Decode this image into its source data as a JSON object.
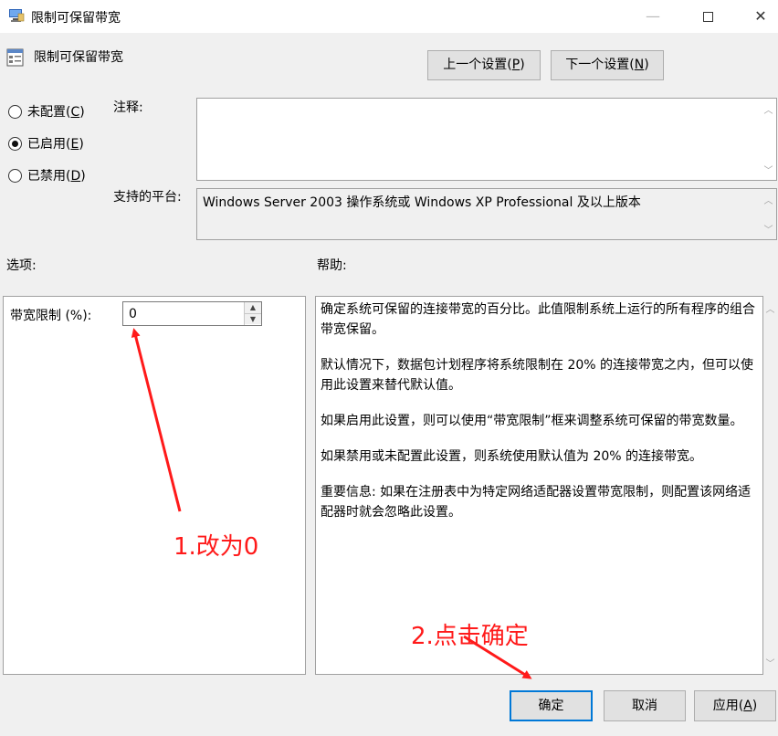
{
  "window": {
    "title": "限制可保留带宽",
    "min_glyph": "—",
    "close_glyph": "✕"
  },
  "header": {
    "title": "限制可保留带宽"
  },
  "nav": {
    "prev": {
      "label": "上一个设置(",
      "key": "P",
      "end": ")"
    },
    "next": {
      "label": "下一个设置(",
      "key": "N",
      "end": ")"
    }
  },
  "state": {
    "not_configured": {
      "label": "未配置(",
      "key": "C",
      "end": ")"
    },
    "enabled": {
      "label": "已启用(",
      "key": "E",
      "end": ")"
    },
    "disabled": {
      "label": "已禁用(",
      "key": "D",
      "end": ")"
    },
    "selected": "enabled"
  },
  "comment": {
    "label": "注释:",
    "value": ""
  },
  "platform": {
    "label": "支持的平台:",
    "value": "Windows Server 2003 操作系统或 Windows XP Professional 及以上版本"
  },
  "options": {
    "label": "选项:",
    "bandwidth_label": "带宽限制 (%):",
    "bandwidth_value": "0"
  },
  "help": {
    "label": "帮助:",
    "paragraphs": [
      "确定系统可保留的连接带宽的百分比。此值限制系统上运行的所有程序的组合带宽保留。",
      "默认情况下，数据包计划程序将系统限制在 20% 的连接带宽之内，但可以使用此设置来替代默认值。",
      "如果启用此设置，则可以使用“带宽限制”框来调整系统可保留的带宽数量。",
      "如果禁用或未配置此设置，则系统使用默认值为 20% 的连接带宽。",
      "重要信息: 如果在注册表中为特定网络适配器设置带宽限制，则配置该网络适配器时就会忽略此设置。"
    ]
  },
  "footer": {
    "ok": "确定",
    "cancel": "取消",
    "apply": {
      "label": "应用(",
      "key": "A",
      "end": ")"
    }
  },
  "annotations": {
    "step1": "1.改为0",
    "step2": "2.点击确定",
    "color": "#ff1a1a"
  },
  "colors": {
    "accent": "#0078d7",
    "window_bg": "#f0f0f0"
  },
  "icons": {
    "title": "policy-window-icon",
    "header": "policy-setting-icon"
  }
}
